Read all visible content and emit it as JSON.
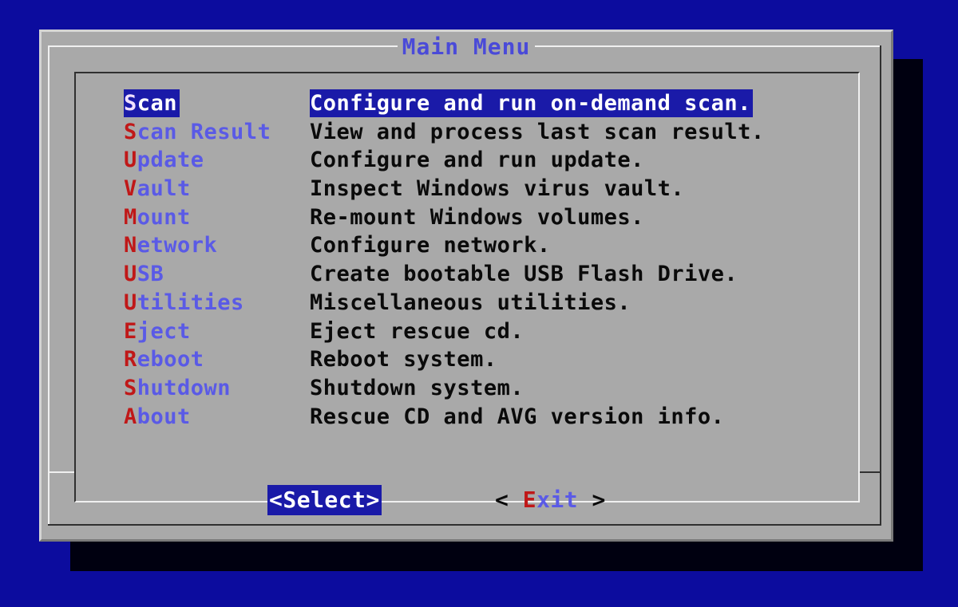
{
  "dialog": {
    "title": "Main Menu"
  },
  "menu": {
    "items": [
      {
        "hotkey": "S",
        "rest": "can",
        "description": "Configure and run on-demand scan.",
        "selected": true
      },
      {
        "hotkey": "S",
        "rest": "can Result",
        "description": "View and process last scan result.",
        "selected": false
      },
      {
        "hotkey": "U",
        "rest": "pdate",
        "description": "Configure and run update.",
        "selected": false
      },
      {
        "hotkey": "V",
        "rest": "ault",
        "description": "Inspect Windows virus vault.",
        "selected": false
      },
      {
        "hotkey": "M",
        "rest": "ount",
        "description": "Re-mount Windows volumes.",
        "selected": false
      },
      {
        "hotkey": "N",
        "rest": "etwork",
        "description": "Configure network.",
        "selected": false
      },
      {
        "hotkey": "U",
        "rest": "SB",
        "description": "Create bootable USB Flash Drive.",
        "selected": false
      },
      {
        "hotkey": "U",
        "rest": "tilities",
        "description": "Miscellaneous utilities.",
        "selected": false
      },
      {
        "hotkey": "E",
        "rest": "ject",
        "description": "Eject rescue cd.",
        "selected": false
      },
      {
        "hotkey": "R",
        "rest": "eboot",
        "description": "Reboot system.",
        "selected": false
      },
      {
        "hotkey": "S",
        "rest": "hutdown",
        "description": "Shutdown system.",
        "selected": false
      },
      {
        "hotkey": "A",
        "rest": "bout",
        "description": "Rescue CD and AVG version info.",
        "selected": false
      }
    ]
  },
  "buttons": {
    "select_label": "<Select>",
    "exit_open": "< ",
    "exit_hotkey": "E",
    "exit_rest": "xit",
    "exit_close": " >"
  },
  "colors": {
    "background": "#0c0c9e",
    "dialog": "#a9a9a9",
    "highlight": "#1a1aa8",
    "hotkey": "#c01818",
    "tag": "#5a5ae6",
    "title": "#4a4ad8"
  }
}
